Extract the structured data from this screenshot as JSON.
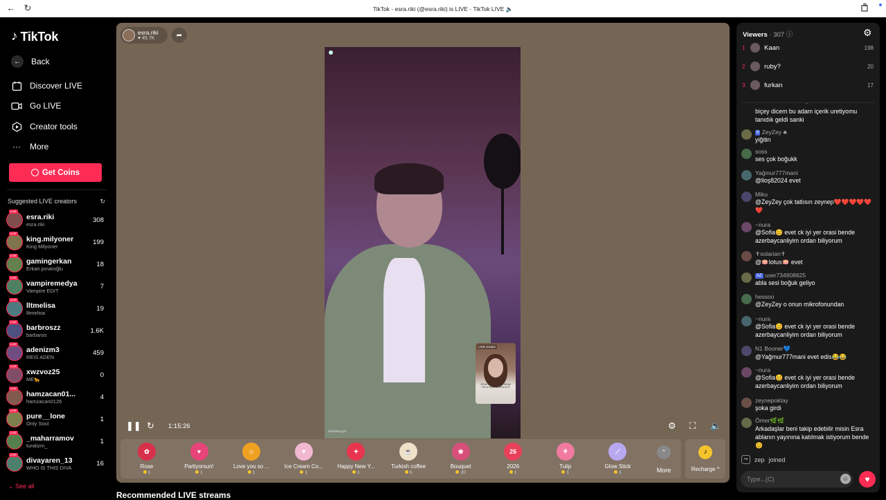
{
  "browser": {
    "title": "TikTok - esra.riki (@esra.riki) is LIVE - TikTok LIVE 🔈",
    "back_icon": "←",
    "reload_icon": "↻"
  },
  "sidebar": {
    "logo_text": "TikTok",
    "back_label": "Back",
    "nav": [
      {
        "label": "Discover LIVE",
        "icon": "calendar-icon"
      },
      {
        "label": "Go LIVE",
        "icon": "camera-icon"
      },
      {
        "label": "Creator tools",
        "icon": "play-icon"
      },
      {
        "label": "More",
        "icon": "more-icon"
      }
    ],
    "get_coins_label": "Get Coins",
    "suggested_header": "Suggested LIVE creators",
    "creators": [
      {
        "name": "esra.riki",
        "sub": "esra.riki",
        "count": "308"
      },
      {
        "name": "king.milyoner",
        "sub": "King Milyoner",
        "count": "199"
      },
      {
        "name": "gamingerkan",
        "sub": "Erkan pınaroğlu",
        "count": "18"
      },
      {
        "name": "vampiremedya",
        "sub": "Vampire EDIT",
        "count": "7"
      },
      {
        "name": "lltmelisa",
        "sub": "lltmelisa",
        "count": "19"
      },
      {
        "name": "barbroszz",
        "sub": "barbaros",
        "count": "1.6K"
      },
      {
        "name": "adenizm3",
        "sub": "REIS ADEN",
        "count": "459"
      },
      {
        "name": "xwzvoz25",
        "sub": "ME🐆",
        "count": "0"
      },
      {
        "name": "hamzacan01...",
        "sub": "hamzacan0126",
        "count": "4"
      },
      {
        "name": "pure__lone",
        "sub": "Only Soul",
        "count": "1"
      },
      {
        "name": "_maharramov",
        "sub": "turalizm_",
        "count": "1"
      },
      {
        "name": "divayaren_13",
        "sub": "WHO IS THIS DIVA",
        "count": "16"
      }
    ],
    "see_all_label": "See all"
  },
  "player": {
    "host_name": "esra.riki",
    "host_likes": "45.7K",
    "elapsed": "1:15:26",
    "pip_label": "LIVE creator",
    "pip_caption": "SPUN NOR DALIM ESRAM YELLEYEN NEJDEN AYIT",
    "watermark": "@ekdenyoyil",
    "gifts": [
      {
        "name": "Rose",
        "price": "1",
        "color": "#d8304a",
        "glyph": "✿"
      },
      {
        "name": "Parliyorsun!",
        "price": "1",
        "color": "#e8447a",
        "glyph": "♥"
      },
      {
        "name": "Love you so ...",
        "price": "1",
        "color": "#f0a020",
        "glyph": "☺"
      },
      {
        "name": "Ice Cream Co...",
        "price": "1",
        "color": "#f2b8d0",
        "glyph": "▼"
      },
      {
        "name": "Happy New Y...",
        "price": "1",
        "color": "#e8344e",
        "glyph": "✦"
      },
      {
        "name": "Turkish coffee",
        "price": "5",
        "color": "#f0e0c8",
        "glyph": "☕"
      },
      {
        "name": "Bouquet",
        "price": "20",
        "color": "#d8507a",
        "glyph": "❀"
      },
      {
        "name": "2026",
        "price": "1",
        "color": "#e8405a",
        "glyph": "26"
      },
      {
        "name": "Tulip",
        "price": "1",
        "color": "#f07aa0",
        "glyph": "⚘"
      },
      {
        "name": "Glow Stick",
        "price": "1",
        "color": "#b8a8f0",
        "glyph": "⟋"
      }
    ],
    "more_label": "More",
    "recharge_label": "Recharge ^"
  },
  "recommended_title": "Recommended LIVE streams",
  "viewers": {
    "label": "Viewers",
    "count": "307",
    "top": [
      {
        "rank": "1",
        "name": "Kaan",
        "score": "198"
      },
      {
        "rank": "2",
        "name": "ruby?",
        "score": "20"
      },
      {
        "rank": "3",
        "name": "furkan",
        "score": "17"
      }
    ]
  },
  "chat": {
    "messages": [
      {
        "user": "",
        "text": "biçey dicem bu adam içerik uretiyomu tanıdık geldi sanki",
        "badge": ""
      },
      {
        "user": "ZeyZey ♣",
        "text": "yiğitin",
        "badge": "9"
      },
      {
        "user": "soss",
        "text": "ses çok boğukk",
        "badge": ""
      },
      {
        "user": "Yağmur777mani",
        "text": "@lloş82024 evet",
        "badge": ""
      },
      {
        "user": "Miku",
        "text": "@ZeyZey çok tatlısın zeynep❤️❤️❤️❤️❤️❤️",
        "badge": ""
      },
      {
        "user": "~nura",
        "text": "@Sofia😊 evet ck iyi yer orasi bende azerbaycanliyim ordan biliyorum",
        "badge": ""
      },
      {
        "user": "✝solarian✝",
        "text": "@🪷lotus🪷 evet",
        "badge": ""
      },
      {
        "user": "user734908625",
        "text": "abla sesi boğuk geliyo",
        "badge": "AZ"
      },
      {
        "user": "hessoo",
        "text": "@ZeyZey o onun mikrofonundan",
        "badge": ""
      },
      {
        "user": "~nura",
        "text": "@Sofia😊 evet ck iyi yer orasi bende azerbaycanliyim ordan biliyorum",
        "badge": ""
      },
      {
        "user": "N1 Booner💙",
        "text": "@Yağmur777mani evet edis😂😂",
        "badge": ""
      },
      {
        "user": "~nura",
        "text": "@Sofia😊 evet ck iyi yer orasi bende azerbaycanliyim ordan biliyorum",
        "badge": ""
      },
      {
        "user": "zeynepoktay",
        "text": "şoka girdi",
        "badge": ""
      },
      {
        "user": "Ömer🌿🌿",
        "text": "Arkadaşlar beni takip edebilir misin Esra ablanın yayınına katılmak istiyorum bende 😊",
        "badge": ""
      }
    ],
    "joined_user": "zep",
    "joined_text": "joined",
    "input_placeholder": "Type...(C)"
  }
}
